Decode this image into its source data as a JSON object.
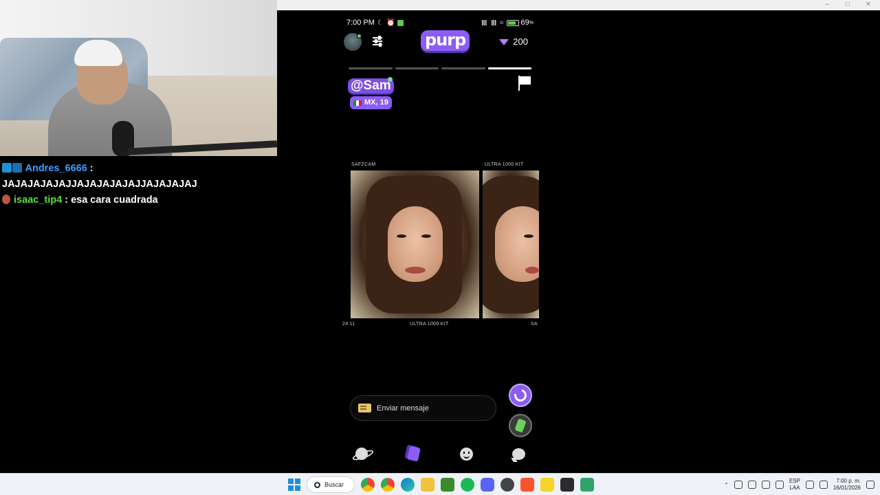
{
  "window": {
    "title": ""
  },
  "chat": {
    "messages": [
      {
        "user": "Andres_6666",
        "sep": " :",
        "text": "JAJAJAJAJAJJAJAJAJAJAJJAJAJAJAJ"
      },
      {
        "user": "isaac_tip4",
        "sep": " :",
        "text": "esa cara cuadrada"
      }
    ]
  },
  "phone": {
    "status": {
      "time": "7:00 PM",
      "battery": "69"
    },
    "app": {
      "logo": "purp",
      "gems": "200"
    },
    "profile": {
      "username": "@Sam",
      "location": "MX, 19"
    },
    "photo_captions": {
      "top_left": "SAFZCAM",
      "top_right": "ULTRA 1000 KIT",
      "bottom_left": "24  11",
      "bottom_mid": "ULTRA 1000 KIT",
      "bottom_right": "SA"
    },
    "message_placeholder": "Enviar mensaje",
    "progress": {
      "segments": 4,
      "active": 4
    },
    "colors": {
      "accent": "#8b5cf6"
    }
  },
  "taskbar": {
    "search_label": "Buscar",
    "lang_line1": "ESP",
    "lang_line2": "LAA",
    "time": "7:00 p. m.",
    "date": "16/01/2026"
  },
  "icons": [
    "windows-icon",
    "search-icon",
    "chrome-icon",
    "edge-icon",
    "folder-icon",
    "minecraft-icon",
    "spotify-icon",
    "discord-icon",
    "brave-icon",
    "notes-icon",
    "terminal-icon",
    "app-icon"
  ]
}
